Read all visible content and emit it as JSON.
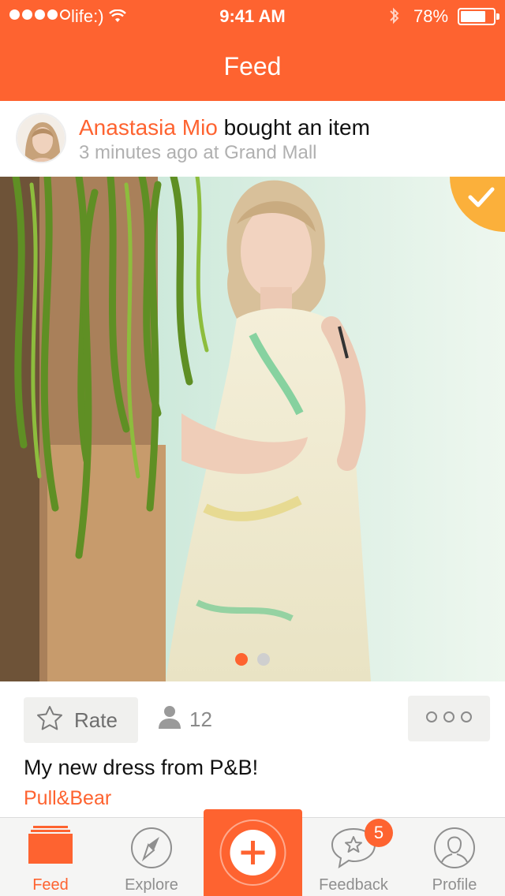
{
  "status_bar": {
    "carrier": "life:)",
    "time": "9:41 AM",
    "battery_percent": "78%",
    "battery_level": 0.78,
    "signal_bars": 4,
    "signal_total": 5
  },
  "header": {
    "title": "Feed"
  },
  "post": {
    "user_name": "Anastasia Mio",
    "action": "bought an item",
    "meta": "3 minutes ago at Grand Mall",
    "photo_pages": 2,
    "photo_active_page": 1,
    "rate_label": "Rate",
    "likes_count": "12",
    "caption": "My new dress from P&B!",
    "brand": "Pull&Bear"
  },
  "tabbar": {
    "tabs": [
      {
        "label": "Feed",
        "icon": "feed-icon",
        "active": true
      },
      {
        "label": "Explore",
        "icon": "compass-icon",
        "active": false
      },
      {
        "label": "",
        "icon": "add-icon",
        "active": false
      },
      {
        "label": "Feedback",
        "icon": "feedback-icon",
        "active": false
      },
      {
        "label": "Profile",
        "icon": "profile-icon",
        "active": false
      }
    ],
    "feedback_badge": "5"
  },
  "colors": {
    "accent": "#fe6330",
    "gray": "#8f8f8f",
    "light": "#f0f0ee"
  }
}
